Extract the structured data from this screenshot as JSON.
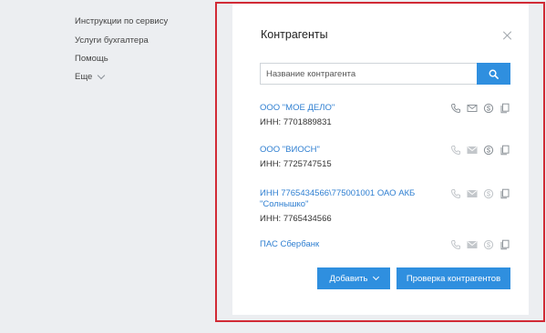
{
  "sidebar": {
    "items": [
      {
        "label": "Инструкции по сервису"
      },
      {
        "label": "Услуги бухгалтера"
      },
      {
        "label": "Помощь"
      },
      {
        "label": "Еще"
      }
    ]
  },
  "modal": {
    "title": "Контрагенты",
    "search": {
      "placeholder": "Название контрагента",
      "value": ""
    },
    "contractors": [
      {
        "name": "ООО \"МОЕ ДЕЛО\"",
        "inn": "ИНН: 7701889831"
      },
      {
        "name": "ООО \"ВИОСН\"",
        "inn": "ИНН: 7725747515"
      },
      {
        "name": "ИНН 7765434566\\775001001 ОАО АКБ \"Солнышко\"",
        "inn": "ИНН: 7765434566"
      },
      {
        "name": "ПАС Сбербанк",
        "inn": ""
      }
    ],
    "buttons": {
      "add": "Добавить",
      "check": "Проверка контрагентов"
    }
  },
  "colors": {
    "accent": "#2f8fdf",
    "link": "#2f7fd1",
    "frame": "#d12a35",
    "background": "#eceef1"
  },
  "icons": [
    "phone-icon",
    "mail-icon",
    "skype-icon",
    "copy-icon",
    "search-icon",
    "close-icon",
    "chevron-down-icon"
  ]
}
